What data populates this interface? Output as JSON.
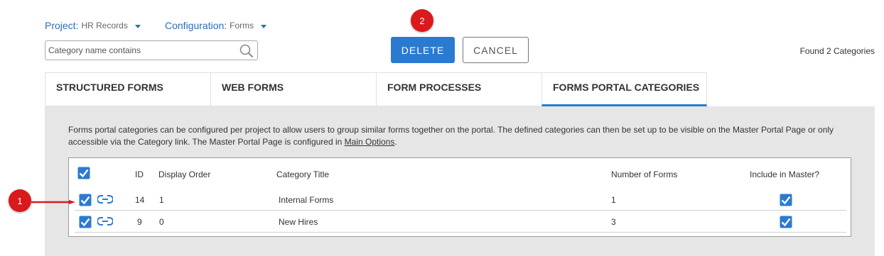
{
  "project": {
    "label": "Project:",
    "value": "HR Records"
  },
  "configuration": {
    "label": "Configuration:",
    "value": "Forms"
  },
  "search": {
    "placeholder": "Category name contains",
    "value": ""
  },
  "buttons": {
    "delete": "DELETE",
    "cancel": "CANCEL"
  },
  "found_text": "Found 2 Categories",
  "callouts": {
    "one": "1",
    "two": "2"
  },
  "tabs": [
    {
      "label": "STRUCTURED FORMS",
      "active": false
    },
    {
      "label": "WEB FORMS",
      "active": false
    },
    {
      "label": "FORM PROCESSES",
      "active": false
    },
    {
      "label": "FORMS PORTAL CATEGORIES",
      "active": true
    }
  ],
  "description": {
    "text": "Forms portal categories can be configured per project to allow users to group similar forms together on the portal. The defined categories can then be set up to be visible on the Master Portal Page or only accessible via the Category link. The Master Portal Page is configured in ",
    "link": "Main Options",
    "end": "."
  },
  "table": {
    "headers": {
      "id": "ID",
      "display_order": "Display Order",
      "category_title": "Category Title",
      "number_of_forms": "Number of Forms",
      "include_in_master": "Include in Master?"
    },
    "rows": [
      {
        "id": "14",
        "display_order": "1",
        "category_title": "Internal Forms",
        "number_of_forms": "1",
        "selected": true,
        "include_in_master": true
      },
      {
        "id": "9",
        "display_order": "0",
        "category_title": "New Hires",
        "number_of_forms": "3",
        "selected": true,
        "include_in_master": true
      }
    ],
    "select_all": true
  },
  "colors": {
    "accent": "#2a7ad2",
    "callout": "#d9191c",
    "panel": "#e6e6e6"
  }
}
